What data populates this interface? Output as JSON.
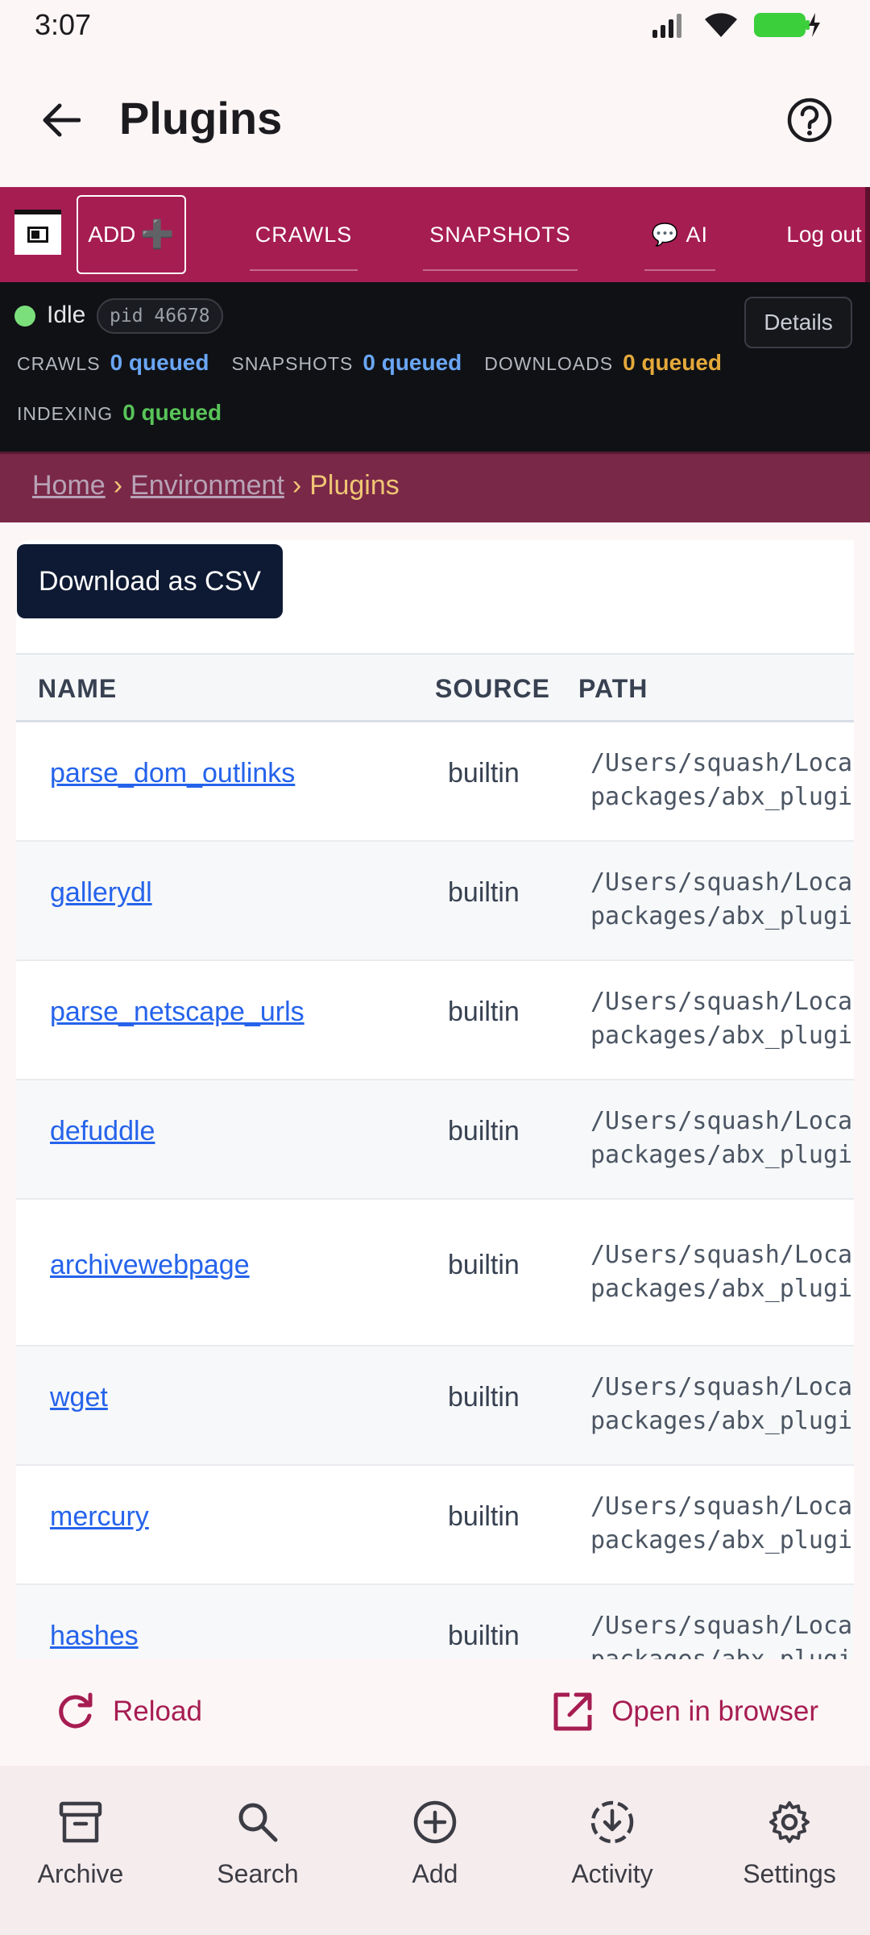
{
  "status_bar": {
    "time": "3:07"
  },
  "app_bar": {
    "title": "Plugins"
  },
  "nav": {
    "add_label": "ADD",
    "add_plus": "➕",
    "crawls": "CRAWLS",
    "snapshots": "SNAPSHOTS",
    "ai": "AI",
    "ai_icon": "💬",
    "logout": "Log out"
  },
  "status_panel": {
    "state": "Idle",
    "pid": "pid 46678",
    "details": "Details",
    "crawls_label": "CRAWLS",
    "crawls_value": "0 queued",
    "snapshots_label": "SNAPSHOTS",
    "snapshots_value": "0 queued",
    "downloads_label": "DOWNLOADS",
    "downloads_value": "0 queued",
    "indexing_label": "INDEXING",
    "indexing_value": "0 queued"
  },
  "breadcrumb": {
    "home": "Home",
    "sep1": "›",
    "environment": "Environment",
    "sep2": "›",
    "current": "Plugins"
  },
  "table": {
    "download_csv": "Download as CSV",
    "headers": {
      "name": "NAME",
      "source": "SOURCE",
      "path": "PATH"
    },
    "rows": [
      {
        "name": "parse_dom_outlinks",
        "source": "builtin",
        "path_line1": "/Users/squash/Local",
        "path_line2": "packages/abx_plugin"
      },
      {
        "name": "gallerydl",
        "source": "builtin",
        "path_line1": "/Users/squash/Local",
        "path_line2": "packages/abx_plugin"
      },
      {
        "name": "parse_netscape_urls",
        "source": "builtin",
        "path_line1": "/Users/squash/Local",
        "path_line2": "packages/abx_plugin"
      },
      {
        "name": "defuddle",
        "source": "builtin",
        "path_line1": "/Users/squash/Local",
        "path_line2": "packages/abx_plugin"
      },
      {
        "name": "archivewebpage",
        "source": "builtin",
        "path_line1": "/Users/squash/Local",
        "path_line2": "packages/abx_plugin"
      },
      {
        "name": "wget",
        "source": "builtin",
        "path_line1": "/Users/squash/Local",
        "path_line2": "packages/abx_plugin"
      },
      {
        "name": "mercury",
        "source": "builtin",
        "path_line1": "/Users/squash/Local",
        "path_line2": "packages/abx_plugin"
      },
      {
        "name": "hashes",
        "source": "builtin",
        "path_line1": "/Users/squash/Local",
        "path_line2": "packages/abx_plugin"
      }
    ]
  },
  "actions": {
    "reload": "Reload",
    "open_in_browser": "Open in browser"
  },
  "bottom_nav": {
    "archive": "Archive",
    "search": "Search",
    "add": "Add",
    "activity": "Activity",
    "settings": "Settings"
  },
  "colors": {
    "brand": "#a61d52",
    "link": "#2563eb",
    "queued_blue": "#6aa6f5",
    "queued_orange": "#e5a93a",
    "queued_green": "#58c458",
    "breadcrumb_bg": "#7a2848"
  }
}
